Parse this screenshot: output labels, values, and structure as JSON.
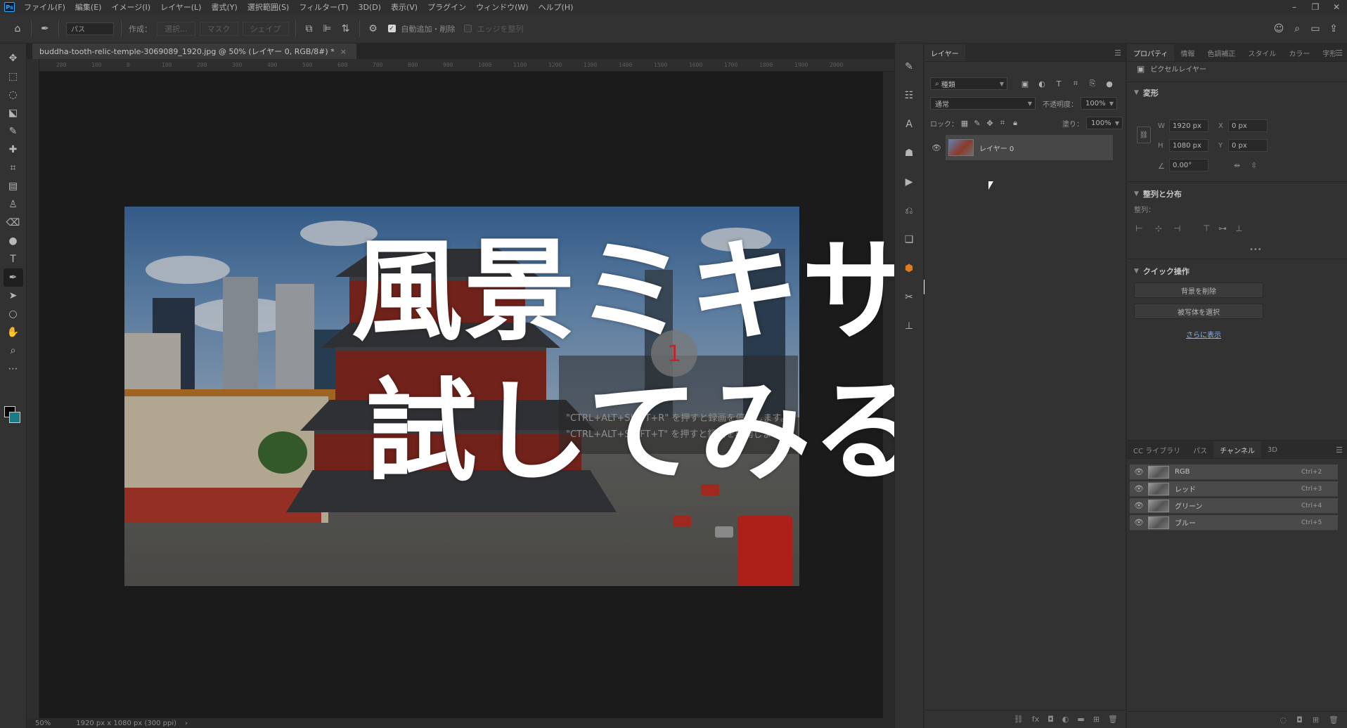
{
  "app": {
    "logo_text": "Ps",
    "menu": [
      "ファイル(F)",
      "編集(E)",
      "イメージ(I)",
      "レイヤー(L)",
      "書式(Y)",
      "選択範囲(S)",
      "フィルター(T)",
      "3D(D)",
      "表示(V)",
      "プラグイン",
      "ウィンドウ(W)",
      "ヘルプ(H)"
    ],
    "window_controls": {
      "minimize": "–",
      "restore": "❐",
      "close": "✕"
    }
  },
  "options": {
    "path_mode": "パス",
    "make_label": "作成：",
    "selection_btn": "選択...",
    "mask_btn": "マスク",
    "shape_btn": "シェイプ",
    "auto_add_delete": "自動追加・削除",
    "align_edges": "エッジを整列"
  },
  "document": {
    "tab_title": "buddha-tooth-relic-temple-3069089_1920.jpg @ 50% (レイヤー 0, RGB/8#) *",
    "close": "×",
    "ruler_ticks": [
      "200",
      "100",
      "0",
      "100",
      "200",
      "300",
      "400",
      "500",
      "600",
      "700",
      "800",
      "900",
      "1000",
      "1100",
      "1200",
      "1300",
      "1400",
      "1500",
      "1600",
      "1700",
      "1800",
      "1900",
      "2000"
    ]
  },
  "overlay": {
    "title_line1": "風景ミキサー",
    "title_line2": "試してみるよ",
    "step_number": "1",
    "shortcut_line1": "\"CTRL+ALT+SHIFT+R\" を押すと録画を停止します。",
    "shortcut_line2": "\"CTRL+ALT+SHIFT+T\" を押すと録画を再開します。"
  },
  "status": {
    "zoom": "50%",
    "doc_info": "1920 px x 1080 px (300 ppi)",
    "arrow": "›"
  },
  "layers": {
    "tab": "レイヤー",
    "kind_filter": "種類",
    "blend_mode": "通常",
    "opacity_label": "不透明度：",
    "opacity_value": "100%",
    "lock_label": "ロック：",
    "fill_label": "塗り：",
    "fill_value": "100%",
    "items": [
      {
        "name": "レイヤー 0"
      }
    ]
  },
  "properties": {
    "tabs": [
      "プロパティ",
      "情報",
      "色調補正",
      "スタイル",
      "カラー",
      "字形"
    ],
    "layer_type": "ピクセルレイヤー",
    "transform_head": "変形",
    "w_label": "W",
    "w_value": "1920 px",
    "x_label": "X",
    "x_value": "0 px",
    "h_label": "H",
    "h_value": "1080 px",
    "y_label": "Y",
    "y_value": "0 px",
    "angle_value": "0.00°",
    "align_head": "整列と分布",
    "align_label": "整列：",
    "more": "•••",
    "quick_head": "クイック操作",
    "remove_bg": "背景を削除",
    "select_subject": "被写体を選択",
    "show_more": "さらに表示"
  },
  "channels": {
    "tabs": [
      "CC ライブラリ",
      "パス",
      "チャンネル",
      "3D"
    ],
    "items": [
      {
        "name": "RGB",
        "key": "Ctrl+2"
      },
      {
        "name": "レッド",
        "key": "Ctrl+3"
      },
      {
        "name": "グリーン",
        "key": "Ctrl+4"
      },
      {
        "name": "ブルー",
        "key": "Ctrl+5"
      }
    ]
  },
  "colors": {
    "accent": "#31a8ff",
    "foreground_swatch": "#000000",
    "background_swatch": "#1a7a86",
    "step_badge_text": "#c0262d"
  }
}
